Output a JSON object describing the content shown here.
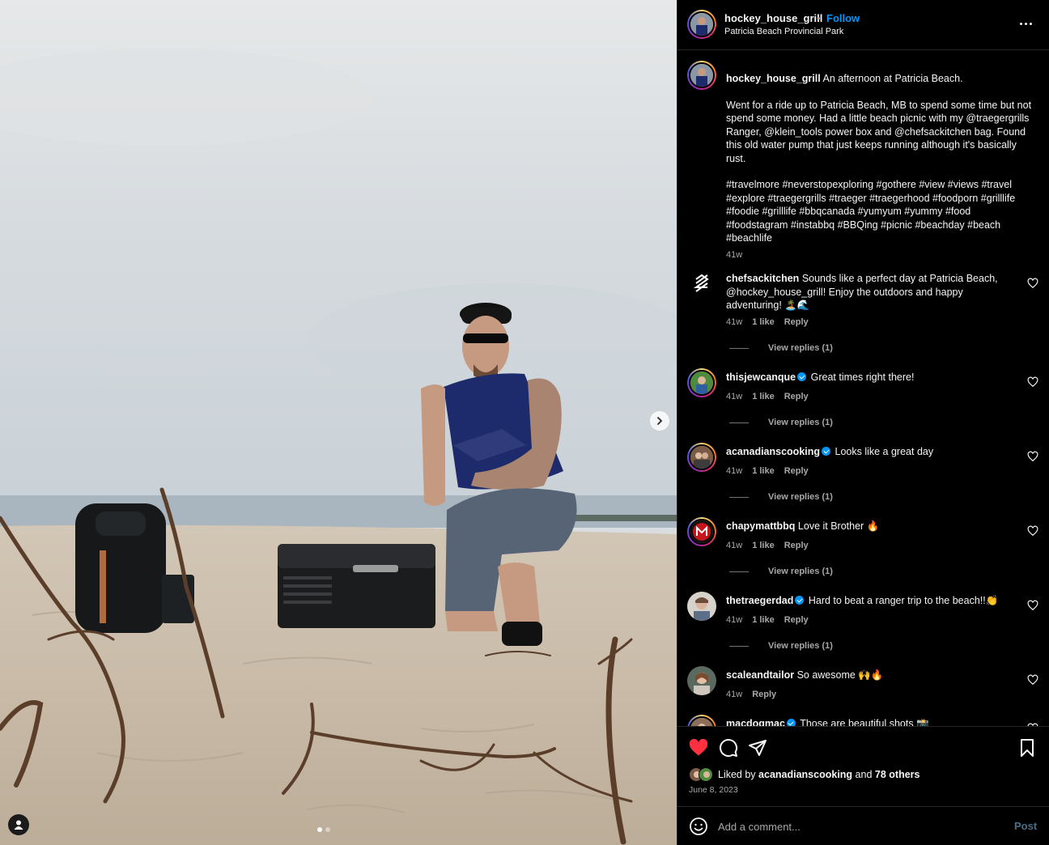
{
  "post": {
    "username": "hockey_house_grill",
    "separator": "•",
    "follow_label": "Follow",
    "location": "Patricia Beach Provincial Park",
    "more_icon": "more-horizontal-icon"
  },
  "caption": {
    "username": "hockey_house_grill",
    "title": "An afternoon at Patricia Beach.",
    "body": "Went for a ride up to Patricia Beach, MB to spend some time but not spend some money. Had a little beach picnic with my @traegergrills Ranger, @klein_tools power box and @chefsackitchen bag. Found this old water pump that just keeps running although it's basically rust.",
    "hashtags": "#travelmore #neverstopexploring #gothere #view #views #travel #explore #traegergrills #traeger #traegerhood #foodporn #grilllife #foodie #grilllife #bbqcanada #yumyum #yummy #food #foodstagram #instabbq #BBQing #picnic #beachday #beach #beachlife",
    "time": "41w"
  },
  "comments": [
    {
      "username": "chefsackitchen",
      "text": "Sounds like a perfect day at Patricia Beach, @hockey_house_grill! Enjoy the outdoors and happy adventuring! 🏝️🌊",
      "time": "41w",
      "likes": "1 like",
      "reply_label": "Reply",
      "view_replies": "View replies (1)"
    },
    {
      "username": "thisjewcanque",
      "text": "Great times right there!",
      "time": "41w",
      "likes": "1 like",
      "reply_label": "Reply",
      "view_replies": "View replies (1)"
    },
    {
      "username": "acanadianscooking",
      "text": "Looks like a great day",
      "time": "41w",
      "likes": "1 like",
      "reply_label": "Reply",
      "view_replies": "View replies (1)"
    },
    {
      "username": "chapymattbbq",
      "text": "Love it Brother 🔥",
      "time": "41w",
      "likes": "1 like",
      "reply_label": "Reply",
      "view_replies": "View replies (1)"
    },
    {
      "username": "thetraegerdad",
      "text": "Hard to beat a ranger trip to the beach!!👏",
      "time": "41w",
      "likes": "1 like",
      "reply_label": "Reply",
      "view_replies": "View replies (1)"
    },
    {
      "username": "scaleandtailor",
      "text": "So awesome 🙌🔥",
      "time": "41w",
      "reply_label": "Reply"
    },
    {
      "username": "macdogmac",
      "text": "Those are beautiful shots 📸"
    }
  ],
  "likes": {
    "prefix": "Liked by",
    "user": "acanadianscooking",
    "and": "and",
    "others": "78 others",
    "date": "June 8, 2023"
  },
  "add_comment": {
    "placeholder": "Add a comment...",
    "post_label": "Post"
  },
  "colors": {
    "accent_blue": "#0095f6",
    "like_red": "#ff3040",
    "muted_text": "#a8a8a8"
  }
}
